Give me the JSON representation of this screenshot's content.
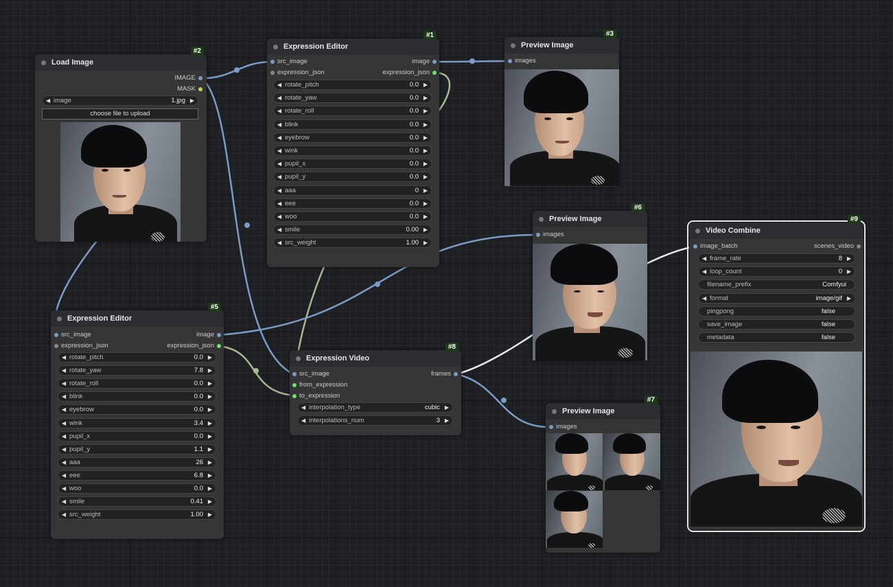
{
  "nodes": {
    "load_image": {
      "title": "Load Image",
      "badge": "#2",
      "outputs": [
        "IMAGE",
        "MASK"
      ],
      "image_widget": {
        "label": "image",
        "value": "1.jpg"
      },
      "upload_button": "choose file to upload"
    },
    "expr1": {
      "title": "Expression Editor",
      "badge": "#1",
      "inputs": [
        "src_image",
        "expression_json"
      ],
      "outputs": [
        "image",
        "expression_json"
      ],
      "widgets": [
        {
          "label": "rotate_pitch",
          "value": "0.0"
        },
        {
          "label": "rotate_yaw",
          "value": "0.0"
        },
        {
          "label": "rotate_roll",
          "value": "0.0"
        },
        {
          "label": "blink",
          "value": "0.0"
        },
        {
          "label": "eyebrow",
          "value": "0.0"
        },
        {
          "label": "wink",
          "value": "0.0"
        },
        {
          "label": "pupil_x",
          "value": "0.0"
        },
        {
          "label": "pupil_y",
          "value": "0.0"
        },
        {
          "label": "aaa",
          "value": "0"
        },
        {
          "label": "eee",
          "value": "0.0"
        },
        {
          "label": "woo",
          "value": "0.0"
        },
        {
          "label": "smile",
          "value": "0.00"
        },
        {
          "label": "src_weight",
          "value": "1.00"
        }
      ]
    },
    "expr5": {
      "title": "Expression Editor",
      "badge": "#5",
      "inputs": [
        "src_image",
        "expression_json"
      ],
      "outputs": [
        "image",
        "expression_json"
      ],
      "widgets": [
        {
          "label": "rotate_pitch",
          "value": "0.0"
        },
        {
          "label": "rotate_yaw",
          "value": "7.8"
        },
        {
          "label": "rotate_roll",
          "value": "0.0"
        },
        {
          "label": "blink",
          "value": "0.0"
        },
        {
          "label": "eyebrow",
          "value": "0.0"
        },
        {
          "label": "wink",
          "value": "3.4"
        },
        {
          "label": "pupil_x",
          "value": "0.0"
        },
        {
          "label": "pupil_y",
          "value": "1.1"
        },
        {
          "label": "aaa",
          "value": "26"
        },
        {
          "label": "eee",
          "value": "6.8"
        },
        {
          "label": "woo",
          "value": "0.0"
        },
        {
          "label": "smile",
          "value": "0.41"
        },
        {
          "label": "src_weight",
          "value": "1.00"
        }
      ]
    },
    "preview3": {
      "title": "Preview Image",
      "badge": "#3",
      "input": "images"
    },
    "preview6": {
      "title": "Preview Image",
      "badge": "#6",
      "input": "images"
    },
    "preview7": {
      "title": "Preview Image",
      "badge": "#7",
      "input": "images"
    },
    "video8": {
      "title": "Expression Video",
      "badge": "#8",
      "inputs": [
        "src_image",
        "from_expression",
        "to_expression"
      ],
      "output": "frames",
      "widgets": [
        {
          "label": "interpolation_type",
          "value": "cubic"
        },
        {
          "label": "interpolations_num",
          "value": "3"
        }
      ]
    },
    "combine9": {
      "title": "Video Combine",
      "badge": "#9",
      "input": "image_batch",
      "output": "scenes_video",
      "widgets": [
        {
          "label": "frame_rate",
          "value": "8",
          "kind": "number"
        },
        {
          "label": "loop_count",
          "value": "0",
          "kind": "number"
        },
        {
          "label": "filename_prefix",
          "value": "Comfyui",
          "kind": "text"
        },
        {
          "label": "format",
          "value": "image/gif",
          "kind": "combo"
        },
        {
          "label": "pingpong",
          "value": "false",
          "kind": "toggle"
        },
        {
          "label": "save_image",
          "value": "false",
          "kind": "toggle"
        },
        {
          "label": "metadata",
          "value": "false",
          "kind": "toggle"
        }
      ]
    }
  },
  "icons": {
    "arrow_left": "◀",
    "arrow_right": "▶"
  },
  "colors": {
    "image_port": "#7a9cc6",
    "json_port": "#6ee06e",
    "wire_image": "#7a9cc6",
    "wire_json": "#a8b890",
    "wire_frames": "#e8e8e8"
  }
}
